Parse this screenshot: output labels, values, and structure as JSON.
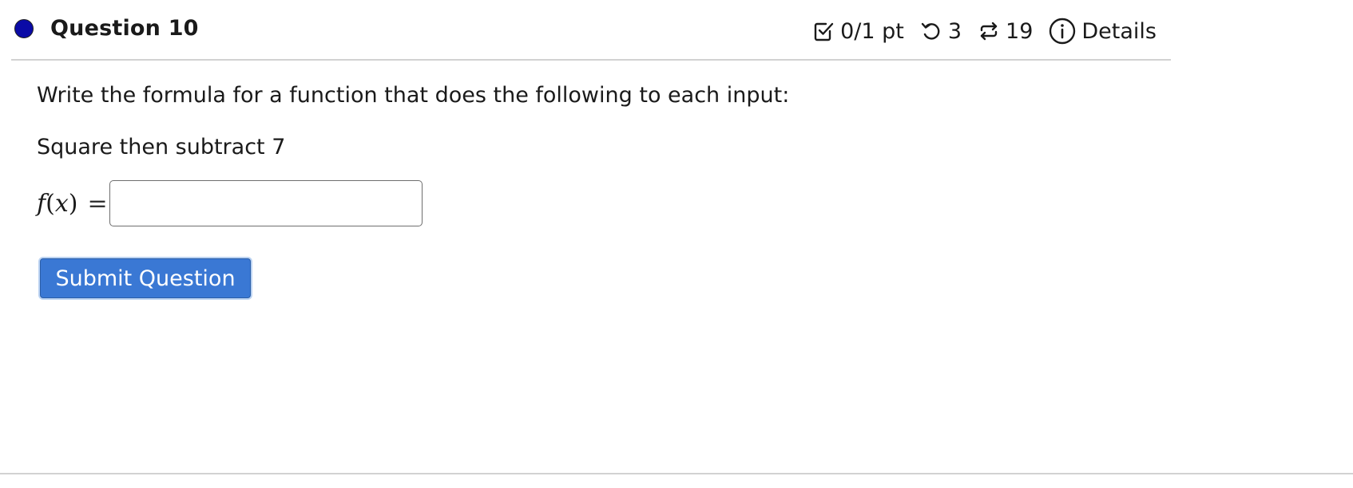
{
  "question": {
    "title": "Question 10",
    "score": "0/1 pt",
    "attempts": "3",
    "versions": "19",
    "details_label": "Details"
  },
  "content": {
    "prompt": "Write the formula for a function that does the following to each input:",
    "instruction": "Square then subtract 7"
  },
  "answer": {
    "fn_name": "f",
    "variable": "x",
    "value": "",
    "placeholder": ""
  },
  "submit": {
    "label": "Submit Question"
  },
  "icons": {
    "status": "status-dot-icon",
    "score": "checkbox-check-icon",
    "attempts": "retry-icon",
    "versions": "repeat-icon",
    "details": "info-circle-icon"
  },
  "colors": {
    "status_dot": "#0a0aa6",
    "submit_bg": "#3a78d4",
    "divider": "#d2d2d2"
  }
}
